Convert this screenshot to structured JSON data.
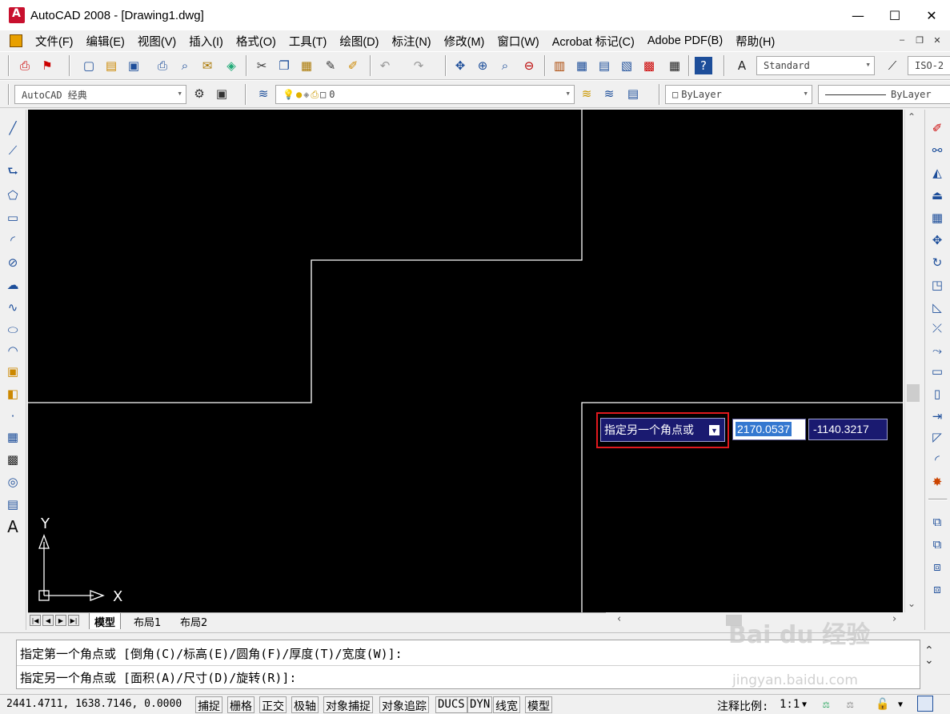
{
  "window": {
    "title": "AutoCAD 2008 - [Drawing1.dwg]",
    "minimize": "—",
    "maximize": "☐",
    "close": "✕"
  },
  "menu": {
    "items": [
      "文件(F)",
      "编辑(E)",
      "视图(V)",
      "插入(I)",
      "格式(O)",
      "工具(T)",
      "绘图(D)",
      "标注(N)",
      "修改(M)",
      "窗口(W)",
      "Acrobat 标记(C)",
      "Adobe PDF(B)",
      "帮助(H)"
    ]
  },
  "toolbar1": {
    "text_style": "Standard",
    "dim_style": "ISO-2"
  },
  "toolbar2": {
    "workspace": "AutoCAD 经典",
    "layer": "0",
    "color": "ByLayer",
    "linetype": "ByLayer"
  },
  "canvas": {
    "background": "#000000",
    "line_color": "#ffffff",
    "ucs_x_label": "X",
    "ucs_y_label": "Y"
  },
  "dynamic_input": {
    "prompt": "指定另一个角点或",
    "x_value": "2170.0537",
    "y_value": "-1140.3217",
    "highlight_color": "#e0191e"
  },
  "layout_tabs": [
    "模型",
    "布局1",
    "布局2"
  ],
  "command": {
    "line1": "指定第一个角点或 [倒角(C)/标高(E)/圆角(F)/厚度(T)/宽度(W)]:",
    "line2": "指定另一个角点或 [面积(A)/尺寸(D)/旋转(R)]:"
  },
  "status": {
    "coords": "2441.4711,  1638.7146, 0.0000",
    "buttons": [
      "捕捉",
      "栅格",
      "正交",
      "极轴",
      "对象捕捉",
      "对象追踪",
      "DUCS",
      "DYN",
      "线宽",
      "模型"
    ],
    "annotation_scale_label": "注释比例:",
    "annotation_scale": "1:1"
  },
  "watermark": {
    "brand": "Bai du 经验",
    "url": "jingyan.baidu.com"
  }
}
